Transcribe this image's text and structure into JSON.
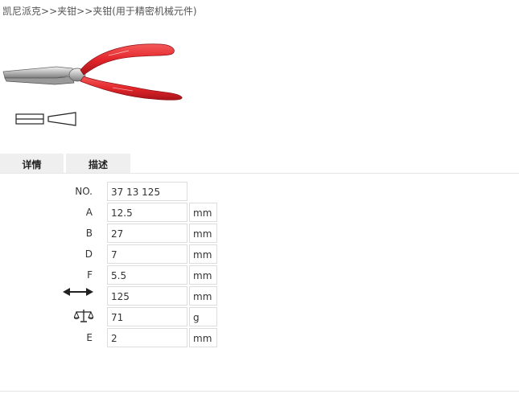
{
  "breadcrumb": {
    "items": [
      "凯尼派克",
      "夹钳",
      "夹钳(用于精密机械元件)"
    ],
    "separator": ">>"
  },
  "tabs": [
    {
      "label": "详情",
      "active": true
    },
    {
      "label": "描述",
      "active": false
    }
  ],
  "specs": [
    {
      "label": "NO.",
      "value": "37 13 125",
      "unit": ""
    },
    {
      "label": "A",
      "value": "12.5",
      "unit": "mm"
    },
    {
      "label": "B",
      "value": "27",
      "unit": "mm"
    },
    {
      "label": "D",
      "value": "7",
      "unit": "mm"
    },
    {
      "label": "F",
      "value": "5.5",
      "unit": "mm"
    },
    {
      "label": "",
      "icon": "length-arrow-icon",
      "value": "125",
      "unit": "mm"
    },
    {
      "label": "",
      "icon": "scale-icon",
      "value": "71",
      "unit": "g"
    },
    {
      "label": "E",
      "value": "2",
      "unit": "mm"
    }
  ],
  "colors": {
    "handle_red": "#e3262b",
    "tab_bg": "#efefef",
    "border": "#dddddd"
  }
}
